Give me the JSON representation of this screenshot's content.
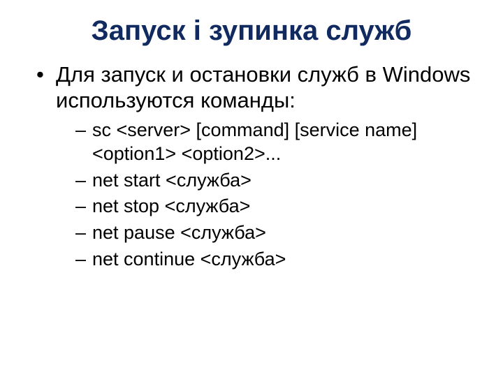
{
  "title": "Запуск і зупинка служб",
  "bullets": {
    "l1_0": "Для запуск и остановки служб в Windows используются команды:",
    "l2_0": " sc <server> [command] [service name] <option1> <option2>...",
    "l2_1": "net start <служба>",
    "l2_2": "net stop <служба>",
    "l2_3": "net pause <служба>",
    "l2_4": "net continue <служба>"
  }
}
